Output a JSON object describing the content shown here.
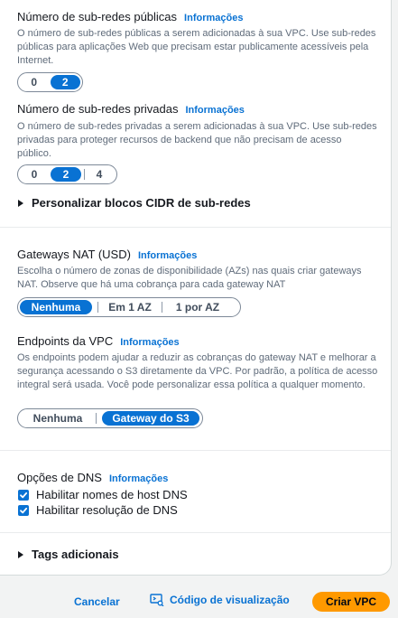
{
  "public_subnets": {
    "label": "Número de sub-redes públicas",
    "info": "Informações",
    "description": "O número de sub-redes públicas a serem adicionadas à sua VPC. Use sub-redes públicas para aplicações Web que precisam estar publicamente acessíveis pela Internet.",
    "options": [
      "0",
      "2"
    ],
    "selected": "2"
  },
  "private_subnets": {
    "label": "Número de sub-redes privadas",
    "info": "Informações",
    "description": "O número de sub-redes privadas a serem adicionadas à sua VPC. Use sub-redes privadas para proteger recursos de backend que não precisam de acesso público.",
    "options": [
      "0",
      "2",
      "4"
    ],
    "selected": "2"
  },
  "cidr_expander": {
    "label": "Personalizar blocos CIDR de sub-redes"
  },
  "nat_gateways": {
    "label": "Gateways NAT (USD)",
    "info": "Informações",
    "description": "Escolha o número de zonas de disponibilidade (AZs) nas quais criar gateways NAT. Observe que há uma cobrança para cada gateway NAT",
    "options": [
      "Nenhuma",
      "Em 1 AZ",
      "1 por AZ"
    ],
    "selected": "Nenhuma"
  },
  "vpc_endpoints": {
    "label": "Endpoints da VPC",
    "info": "Informações",
    "description": "Os endpoints podem ajudar a reduzir as cobranças do gateway NAT e melhorar a segurança acessando o S3 diretamente da VPC. Por padrão, a política de acesso integral será usada. Você pode personalizar essa política a qualquer momento.",
    "options": [
      "Nenhuma",
      "Gateway do S3"
    ],
    "selected": "Gateway do S3"
  },
  "dns": {
    "label": "Opções de DNS",
    "info": "Informações",
    "hostnames_label": "Habilitar nomes de host DNS",
    "hostnames_checked": true,
    "resolution_label": "Habilitar resolução de DNS",
    "resolution_checked": true
  },
  "tags_expander": {
    "label": "Tags adicionais"
  },
  "footer": {
    "cancel_label": "Cancelar",
    "preview_code_label": "Código de visualização",
    "create_label": "Criar VPC"
  },
  "colors": {
    "accent": "#0972d3",
    "primary_button": "#ff9900",
    "description": "#5f6b7a"
  },
  "icons": {
    "checkbox": "check-icon",
    "expander": "caret-right-icon",
    "preview": "code-preview-icon"
  }
}
